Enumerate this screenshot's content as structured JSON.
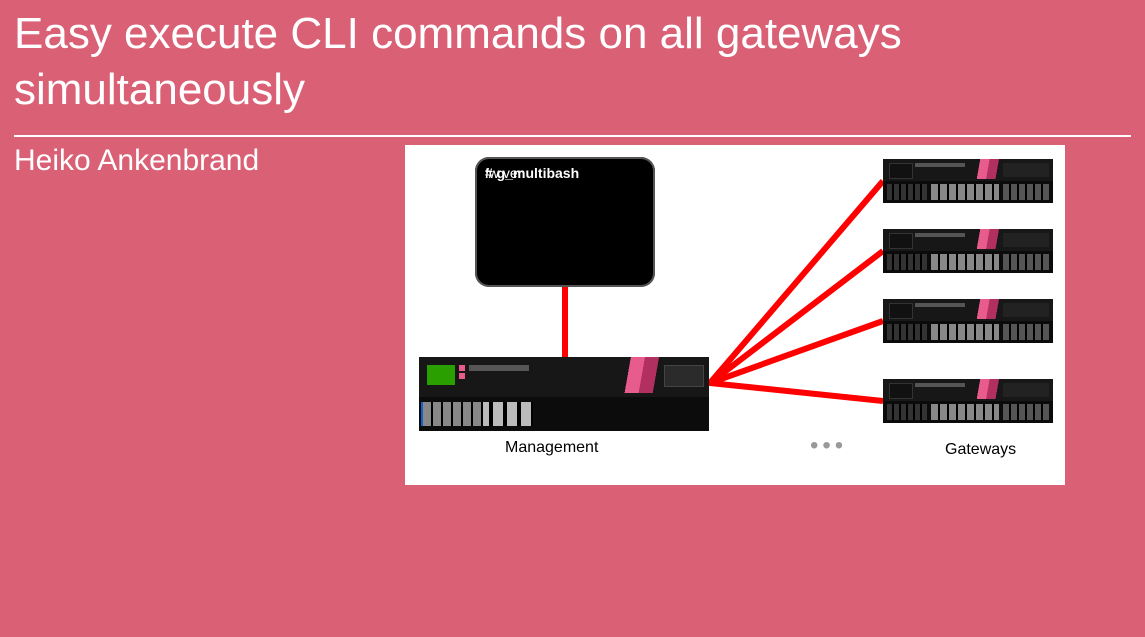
{
  "title": "Easy execute CLI commands on all gateways simultaneously",
  "author": "Heiko Ankenbrand",
  "figure": {
    "terminal_command_a": "# g_multibash",
    "terminal_command_b": " fw ver",
    "label_management": "Management",
    "label_gateways": "Gateways",
    "ellipsis": "•••",
    "gateway_count": 4
  }
}
